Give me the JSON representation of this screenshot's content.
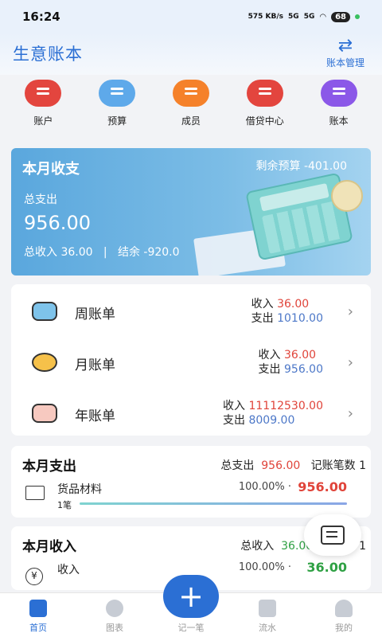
{
  "status": {
    "time": "16:24",
    "speed": "575 KB/s",
    "net1": "5G",
    "net2": "5G",
    "battery": "68"
  },
  "header": {
    "title": "生意账本",
    "manage_label": "账本管理"
  },
  "quick": [
    {
      "label": "账户",
      "color": "#e3453e"
    },
    {
      "label": "预算",
      "color": "#5ea9ea"
    },
    {
      "label": "成员",
      "color": "#f5812a"
    },
    {
      "label": "借贷中心",
      "color": "#e3453e"
    },
    {
      "label": "账本",
      "color": "#8b58e8"
    }
  ],
  "month": {
    "title": "本月收支",
    "budget": "剩余预算 -401.00",
    "expense_label": "总支出",
    "expense_value": "956.00",
    "summary": "总收入 36.00   |   结余 -920.0"
  },
  "bills": [
    {
      "name": "周账单",
      "inc_label": "收入",
      "inc": "36.00",
      "exp_label": "支出",
      "exp": "1010.00"
    },
    {
      "name": "月账单",
      "inc_label": "收入",
      "inc": "36.00",
      "exp_label": "支出",
      "exp": "956.00"
    },
    {
      "name": "年账单",
      "inc_label": "收入",
      "inc": "11112530.00",
      "exp_label": "支出",
      "exp": "8009.00"
    }
  ],
  "expense": {
    "title": "本月支出",
    "total_label": "总支出",
    "total": "956.00",
    "count_label": "记账笔数",
    "count": "1",
    "category": {
      "name": "货品材料",
      "pct": "100.00% ·",
      "amount": "956.00",
      "count": "1笔",
      "progress": 1.0
    }
  },
  "income": {
    "title": "本月收入",
    "total_label": "总收入",
    "total": "36.00",
    "count": "1",
    "category": {
      "name": "收入",
      "pct": "100.00% ·",
      "amount": "36.00"
    }
  },
  "tabs": [
    {
      "label": "首页"
    },
    {
      "label": "图表"
    },
    {
      "label": "记一笔"
    },
    {
      "label": "流水"
    },
    {
      "label": "我的"
    }
  ]
}
